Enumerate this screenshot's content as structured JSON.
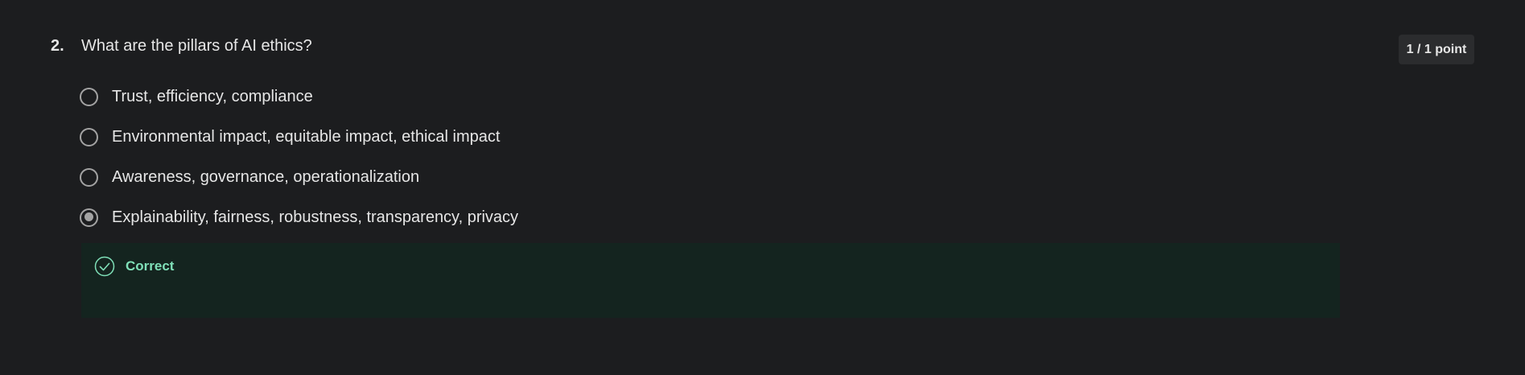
{
  "question": {
    "number": "2.",
    "text": "What are the pillars of AI ethics?",
    "points": "1 / 1 point",
    "options": [
      {
        "label": "Trust, efficiency, compliance",
        "selected": false
      },
      {
        "label": "Environmental impact, equitable impact, ethical impact",
        "selected": false
      },
      {
        "label": "Awareness, governance, operationalization",
        "selected": false
      },
      {
        "label": "Explainability, fairness, robustness, transparency, privacy",
        "selected": true
      }
    ],
    "feedback": {
      "label": "Correct",
      "icon": "check-circle-icon",
      "color": "#7fe0b8",
      "background": "#14241f"
    }
  },
  "colors": {
    "background": "#1c1d1f",
    "text": "#e6e6e6",
    "radio": "#a3a3a3",
    "badge_background": "#2b2c2e"
  }
}
